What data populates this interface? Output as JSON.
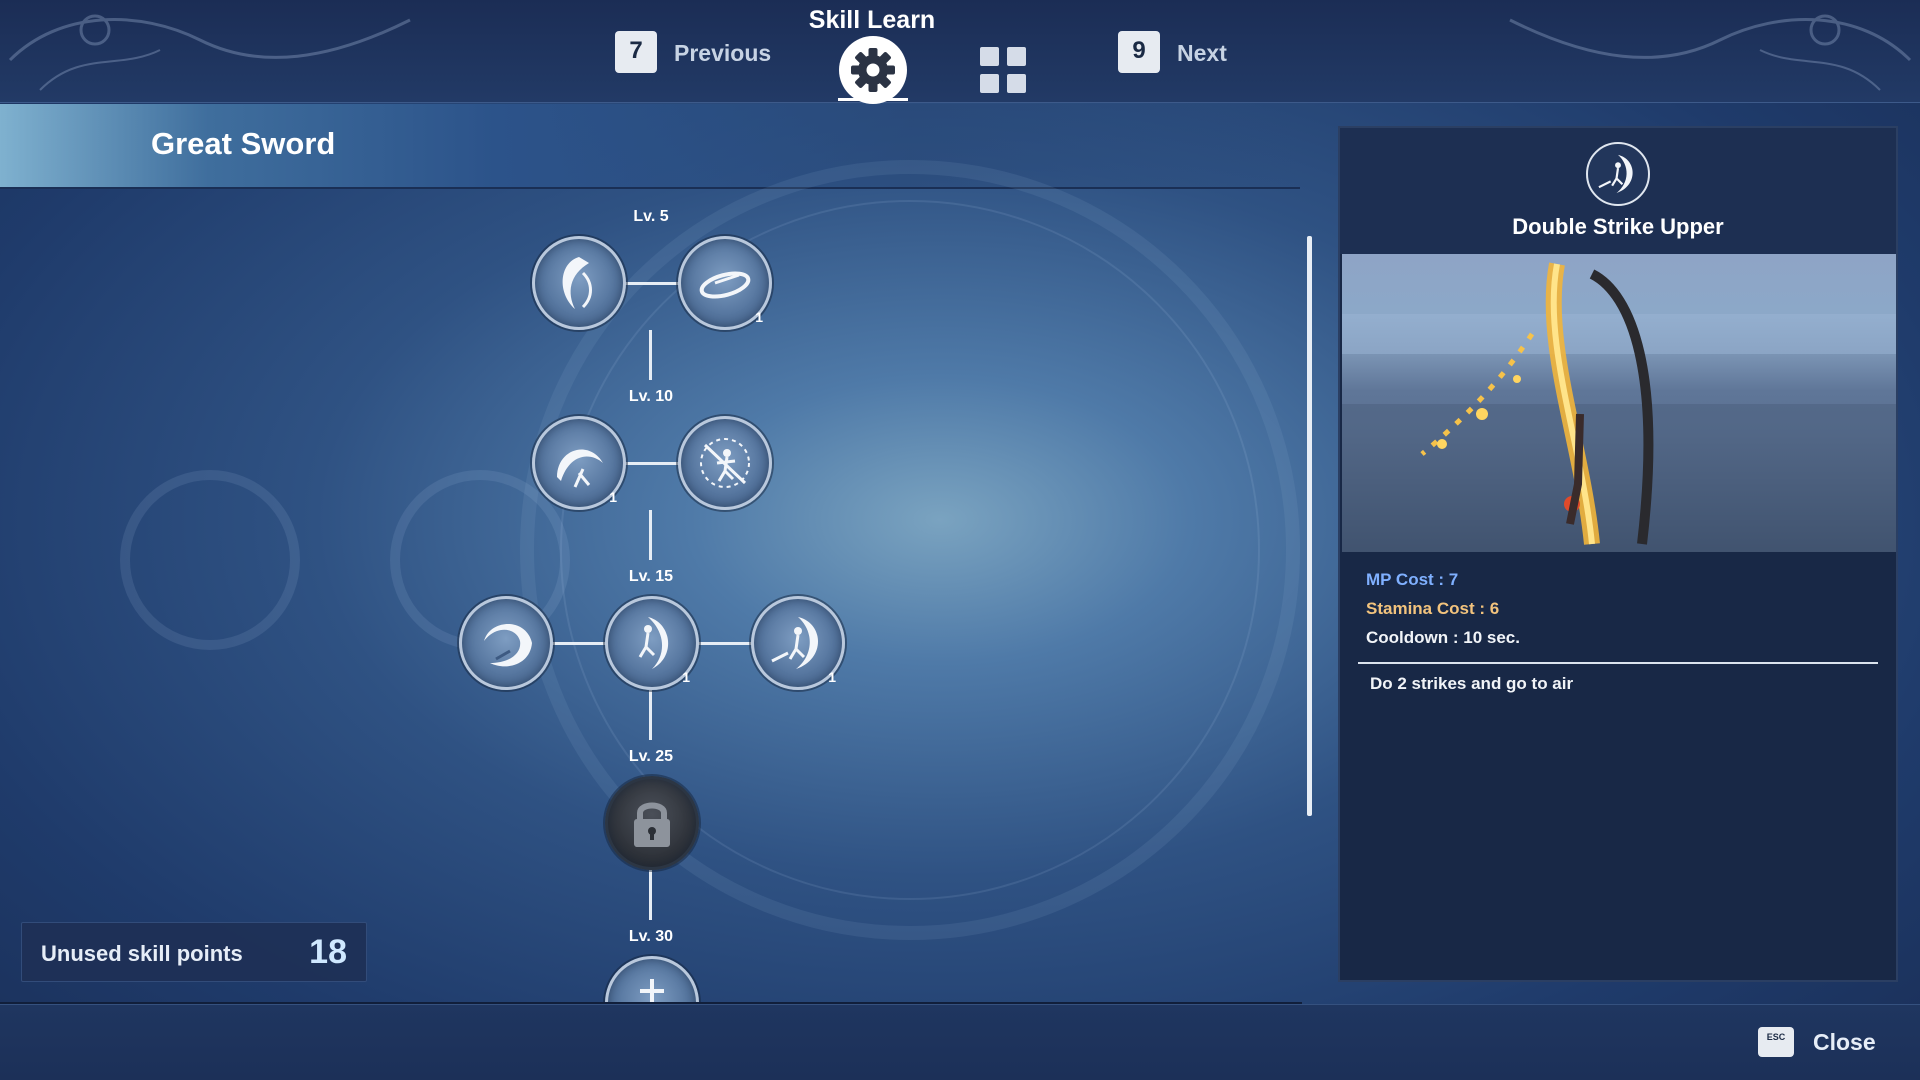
{
  "topbar": {
    "title": "Skill Learn",
    "previous": {
      "key": "7",
      "label": "Previous"
    },
    "next": {
      "key": "9",
      "label": "Next"
    },
    "tabs": [
      {
        "icon": "gear-icon",
        "active": true
      },
      {
        "icon": "grid-icon",
        "active": false
      }
    ]
  },
  "category": {
    "title": "Great Sword"
  },
  "tree": {
    "levels": [
      {
        "label": "Lv. 5"
      },
      {
        "label": "Lv. 10"
      },
      {
        "label": "Lv. 15"
      },
      {
        "label": "Lv. 25"
      },
      {
        "label": "Lv. 30"
      }
    ],
    "nodes": {
      "lv5a": {
        "icon": "slash-wave-icon",
        "count": ""
      },
      "lv5b": {
        "icon": "spin-slash-icon",
        "count": "1"
      },
      "lv10a": {
        "icon": "crescent-slash-icon",
        "count": "1"
      },
      "lv10b": {
        "icon": "cross-strike-icon",
        "count": ""
      },
      "lv15a": {
        "icon": "moon-slash-icon",
        "count": ""
      },
      "lv15b": {
        "icon": "leap-strike-icon",
        "count": "1"
      },
      "lv15c": {
        "icon": "double-strike-upper-icon",
        "count": "1"
      },
      "lv25": {
        "icon": "lock-icon",
        "count": ""
      },
      "lv30": {
        "icon": "sword-plunge-icon",
        "count": ""
      }
    }
  },
  "points": {
    "label": "Unused skill points",
    "value": "18"
  },
  "detail": {
    "name": "Double Strike Upper",
    "icon": "double-strike-upper-icon",
    "mp": "MP Cost : 7",
    "stamina": "Stamina Cost : 6",
    "cooldown": "Cooldown : 10 sec.",
    "description": "Do 2 strikes and go to air",
    "colors": {
      "mp": "#7fb0ff",
      "stamina": "#f2c37d"
    }
  },
  "footer": {
    "close_key": "ESC",
    "close_label": "Close"
  }
}
